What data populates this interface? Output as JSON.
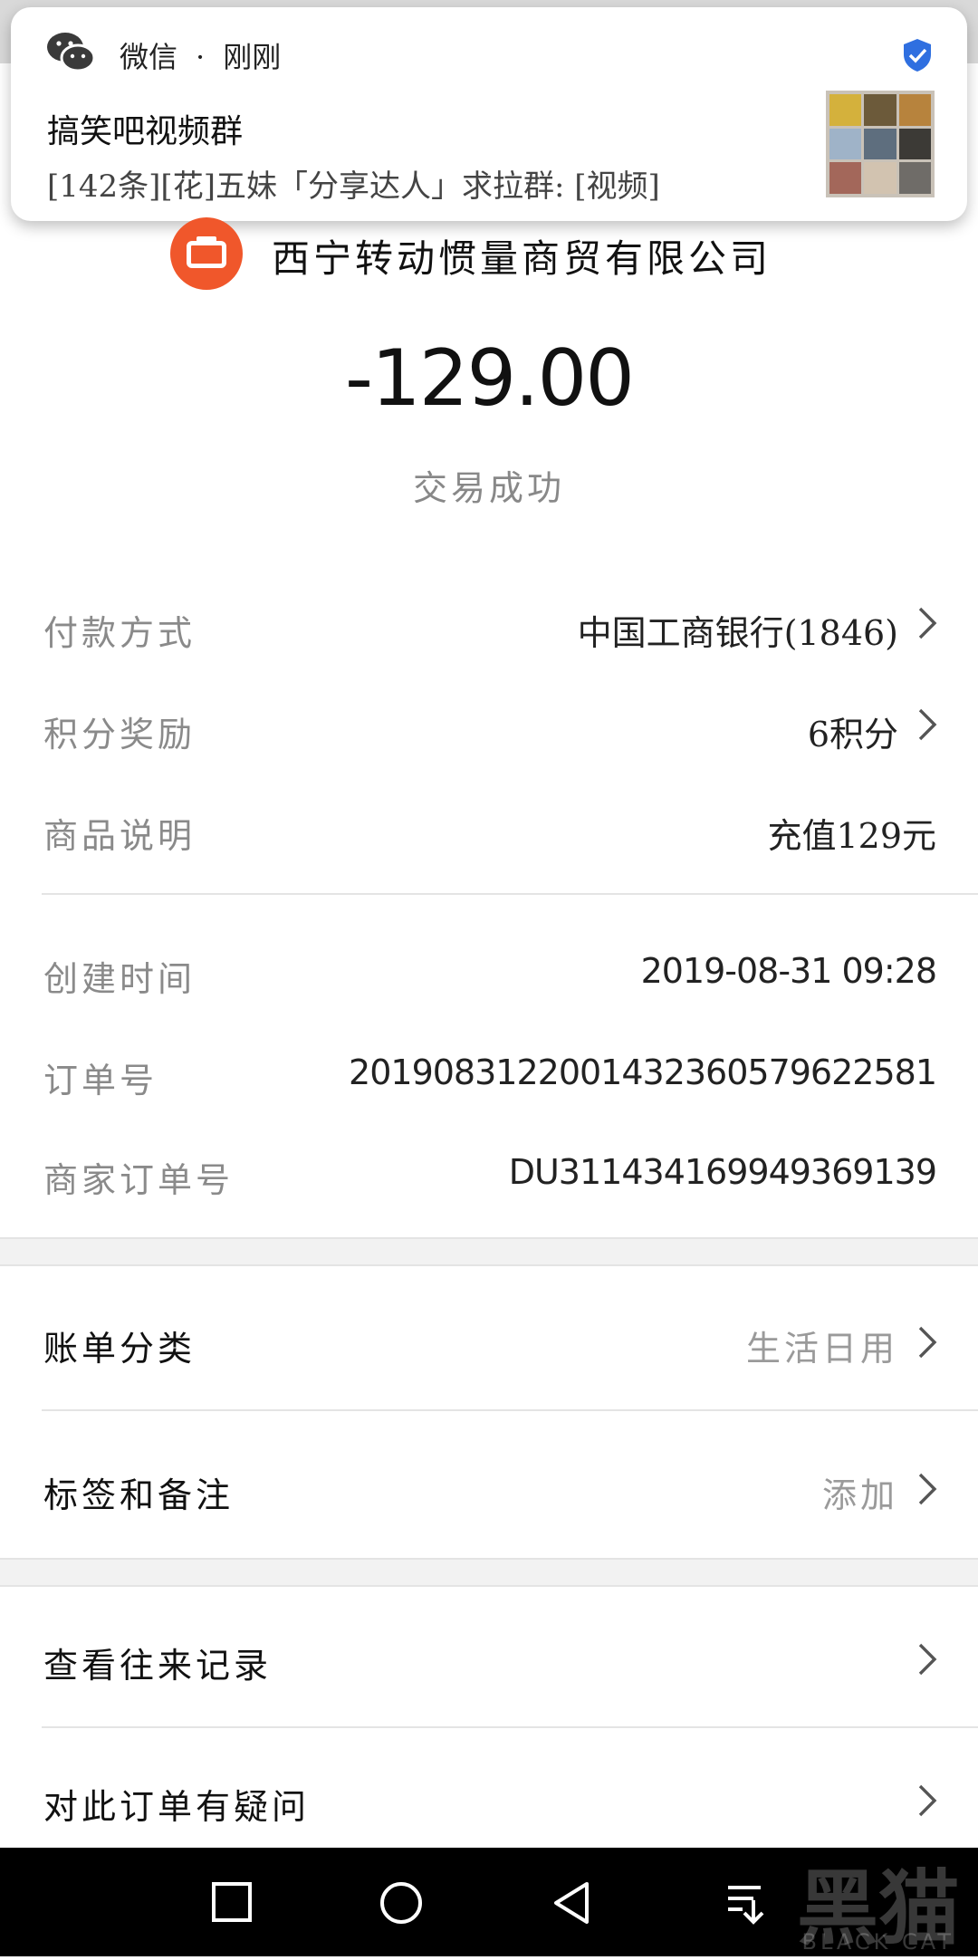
{
  "notification": {
    "app_name": "微信",
    "separator": "·",
    "time": "刚刚",
    "title": "搞笑吧视频群",
    "message": "[142条][花]五妹「分享达人」求拉群: [视频]"
  },
  "merchant": {
    "name": "西宁转动惯量商贸有限公司"
  },
  "amount": "-129.00",
  "status": "交易成功",
  "details": [
    {
      "label": "付款方式",
      "value": "中国工商银行(1846)"
    },
    {
      "label": "积分奖励",
      "value": "6积分"
    },
    {
      "label": "商品说明",
      "value": "充值129元"
    }
  ],
  "order_info": [
    {
      "label": "创建时间",
      "value": "2019-08-31 09:28"
    },
    {
      "label": "订单号",
      "value": "2019083122001432360579622581"
    },
    {
      "label": "商家订单号",
      "value": "DU311434169949369139"
    }
  ],
  "category": {
    "label": "账单分类",
    "value": "生活日用"
  },
  "tags": {
    "label": "标签和备注",
    "value": "添加"
  },
  "history": {
    "label": "查看往来记录"
  },
  "question": {
    "label": "对此订单有疑问"
  },
  "watermark": {
    "title": "黑猫",
    "subtitle": "BLACK CAT"
  },
  "colors": {
    "merchant_logo": "#f0572b",
    "verified_badge": "#2f6fe0"
  }
}
